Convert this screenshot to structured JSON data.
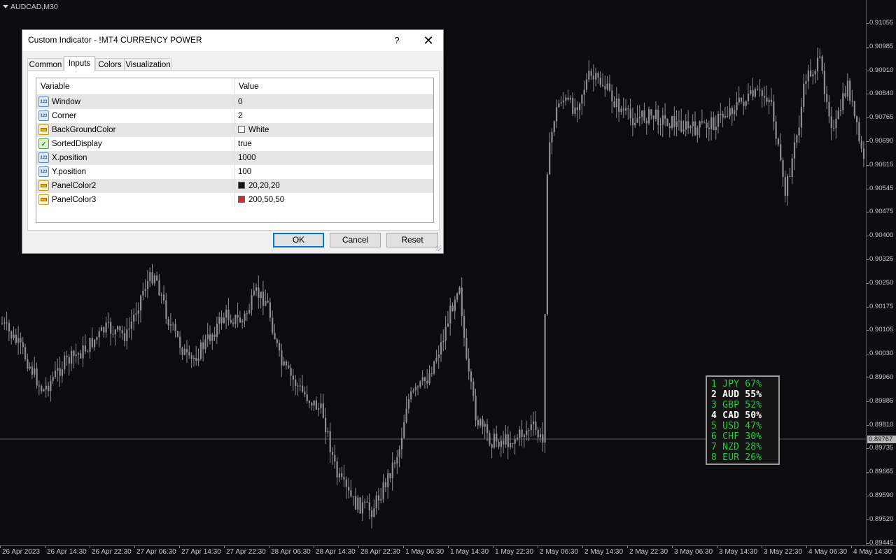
{
  "chart": {
    "symbol": "AUDCAD,M30",
    "current_price": "0.89767",
    "price_labels": [
      "0.91055",
      "0.90985",
      "0.90910",
      "0.90840",
      "0.90765",
      "0.90690",
      "0.90615",
      "0.90545",
      "0.90475",
      "0.90400",
      "0.90325",
      "0.90250",
      "0.90175",
      "0.90105",
      "0.90030",
      "0.89960",
      "0.89885",
      "0.89810",
      "0.89735",
      "0.89665",
      "0.89590",
      "0.89520",
      "0.89445"
    ],
    "time_labels": [
      "26 Apr 2023",
      "26 Apr 14:30",
      "26 Apr 22:30",
      "27 Apr 06:30",
      "27 Apr 14:30",
      "27 Apr 22:30",
      "28 Apr 06:30",
      "28 Apr 14:30",
      "28 Apr 22:30",
      "1 May 06:30",
      "1 May 14:30",
      "1 May 22:30",
      "2 May 06:30",
      "2 May 14:30",
      "2 May 22:30",
      "3 May 06:30",
      "3 May 14:30",
      "3 May 22:30",
      "4 May 06:30",
      "4 May 14:30"
    ],
    "candle_color": "#8f8f8f",
    "background": "#0b0b10"
  },
  "currency_panel": {
    "rows": [
      {
        "rank": "1",
        "currency": "JPY",
        "percent": "67%",
        "color": "#22cc44"
      },
      {
        "rank": "2",
        "currency": "AUD",
        "percent": "55%",
        "color": "#ffffff"
      },
      {
        "rank": "3",
        "currency": "GBP",
        "percent": "52%",
        "color": "#22cc44"
      },
      {
        "rank": "4",
        "currency": "CAD",
        "percent": "50%",
        "color": "#ffffff"
      },
      {
        "rank": "5",
        "currency": "USD",
        "percent": "47%",
        "color": "#22cc44"
      },
      {
        "rank": "6",
        "currency": "CHF",
        "percent": "30%",
        "color": "#22cc44"
      },
      {
        "rank": "7",
        "currency": "NZD",
        "percent": "28%",
        "color": "#22cc44"
      },
      {
        "rank": "8",
        "currency": "EUR",
        "percent": "26%",
        "color": "#22cc44"
      }
    ]
  },
  "dialog": {
    "title": "Custom Indicator - !MT4 CURRENCY POWER",
    "help_label": "?",
    "close_label": "✕",
    "tabs": [
      {
        "label": "Common",
        "active": false
      },
      {
        "label": "Inputs",
        "active": true
      },
      {
        "label": "Colors",
        "active": false
      },
      {
        "label": "Visualization",
        "active": false
      }
    ],
    "table": {
      "header_variable": "Variable",
      "header_value": "Value",
      "rows": [
        {
          "name": "Window",
          "value": "0",
          "icon": "number-icon"
        },
        {
          "name": "Corner",
          "value": "2",
          "icon": "number-icon"
        },
        {
          "name": "BackGroundColor",
          "value": "White",
          "icon": "color-icon",
          "swatch": "#ffffff"
        },
        {
          "name": "SortedDisplay",
          "value": "true",
          "icon": "boolean-icon"
        },
        {
          "name": "X.position",
          "value": "1000",
          "icon": "number-icon"
        },
        {
          "name": "Y.position",
          "value": "100",
          "icon": "number-icon"
        },
        {
          "name": "PanelColor2",
          "value": "20,20,20",
          "icon": "color-icon",
          "swatch": "#141414"
        },
        {
          "name": "PanelColor3",
          "value": "200,50,50",
          "icon": "color-icon",
          "swatch": "#c83232"
        }
      ]
    },
    "ok_label": "OK",
    "cancel_label": "Cancel",
    "reset_label": "Reset"
  }
}
